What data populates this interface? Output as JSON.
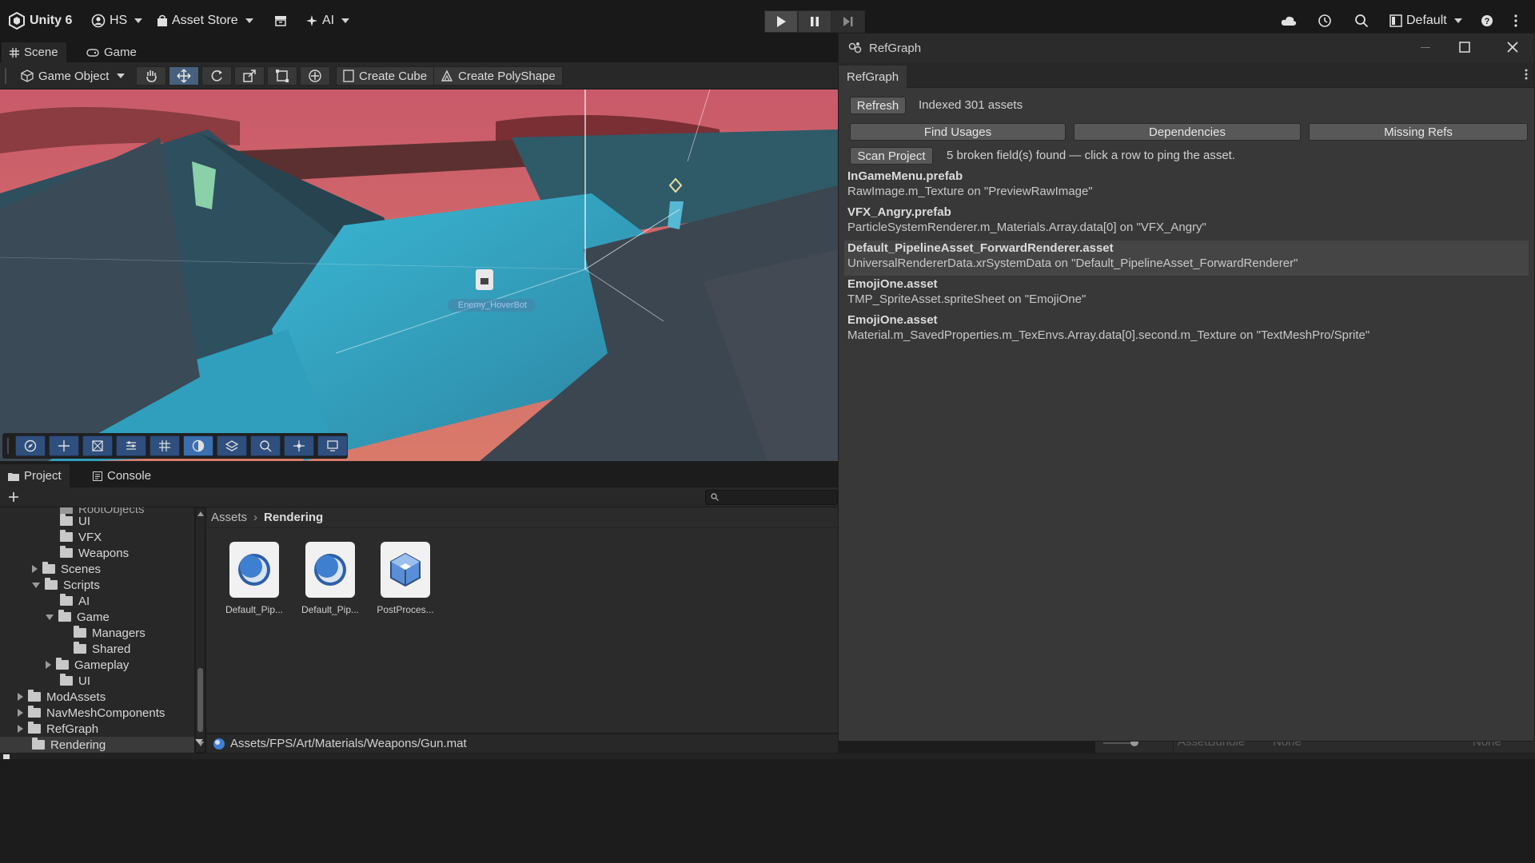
{
  "topbar": {
    "app_title": "Unity 6",
    "account": "HS",
    "asset_store": "Asset Store",
    "ai": "AI",
    "layout": "Default"
  },
  "scene_tabs": [
    {
      "label": "Scene"
    },
    {
      "label": "Game"
    }
  ],
  "scene_toolbar": {
    "game_object": "Game Object",
    "create_cube": "Create Cube",
    "create_polyshape": "Create PolyShape"
  },
  "viewport": {
    "enemy_label": "Enemy_HoverBot"
  },
  "project": {
    "tabs": [
      {
        "label": "Project"
      },
      {
        "label": "Console"
      }
    ],
    "tree": [
      {
        "label": "RootObjects"
      },
      {
        "label": "UI"
      },
      {
        "label": "VFX"
      },
      {
        "label": "Weapons"
      },
      {
        "label": "Scenes"
      },
      {
        "label": "Scripts"
      },
      {
        "label": "AI"
      },
      {
        "label": "Game"
      },
      {
        "label": "Managers"
      },
      {
        "label": "Shared"
      },
      {
        "label": "Gameplay"
      },
      {
        "label": "UI"
      },
      {
        "label": "ModAssets"
      },
      {
        "label": "NavMeshComponents"
      },
      {
        "label": "RefGraph"
      },
      {
        "label": "Rendering"
      }
    ],
    "breadcrumb": {
      "root": "Assets",
      "current": "Rendering"
    },
    "assets": [
      {
        "name": "Default_Pip..."
      },
      {
        "name": "Default_Pip..."
      },
      {
        "name": "PostProces..."
      }
    ],
    "path": "Assets/FPS/Art/Materials/Weapons/Gun.mat"
  },
  "refgraph": {
    "window_title": "RefGraph",
    "tab_label": "RefGraph",
    "refresh_label": "Refresh",
    "indexed_text": "Indexed 301 assets",
    "find_usages_label": "Find Usages",
    "dependencies_label": "Dependencies",
    "missing_refs_label": "Missing Refs",
    "scan_project_label": "Scan Project",
    "scan_result_text": "5 broken field(s) found — click a row to ping the asset.",
    "results": [
      {
        "asset": "InGameMenu.prefab",
        "detail": "RawImage.m_Texture on \"PreviewRawImage\""
      },
      {
        "asset": "VFX_Angry.prefab",
        "detail": "ParticleSystemRenderer.m_Materials.Array.data[0] on \"VFX_Angry\""
      },
      {
        "asset": "Default_PipelineAsset_ForwardRenderer.asset",
        "detail": "UniversalRendererData.xrSystemData on \"Default_PipelineAsset_ForwardRenderer\""
      },
      {
        "asset": "EmojiOne.asset",
        "detail": "TMP_SpriteAsset.spriteSheet on \"EmojiOne\""
      },
      {
        "asset": "EmojiOne.asset",
        "detail": "Material.m_SavedProperties.m_TexEnvs.Array.data[0].second.m_Texture on \"TextMeshPro/Sprite\""
      }
    ]
  },
  "inspector_peek": {
    "assetbundle_label": "AssetBundle",
    "assetbundle_value": "None",
    "variant_value": "None"
  }
}
